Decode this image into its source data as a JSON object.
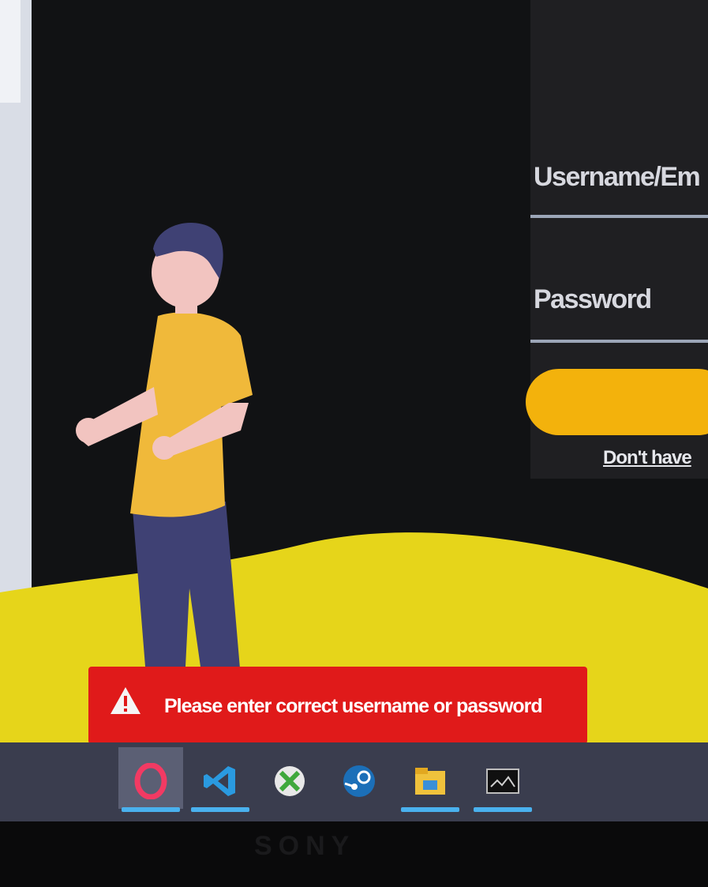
{
  "login": {
    "username_label": "Username/Em",
    "password_label": "Password",
    "signup_link": "Don't have"
  },
  "toast": {
    "message": "Please enter correct username or password",
    "icon": "warning-icon",
    "color": "#e01a1a"
  },
  "taskbar": {
    "items": [
      {
        "icon": "opera-icon"
      },
      {
        "icon": "vscode-icon"
      },
      {
        "icon": "xbox-icon"
      },
      {
        "icon": "steam-icon"
      },
      {
        "icon": "file-explorer-icon"
      },
      {
        "icon": "terminal-icon"
      }
    ]
  },
  "colors": {
    "accent": "#f3b20c",
    "hill": "#e6d51a",
    "background": "#111214"
  },
  "brand": "SONY"
}
